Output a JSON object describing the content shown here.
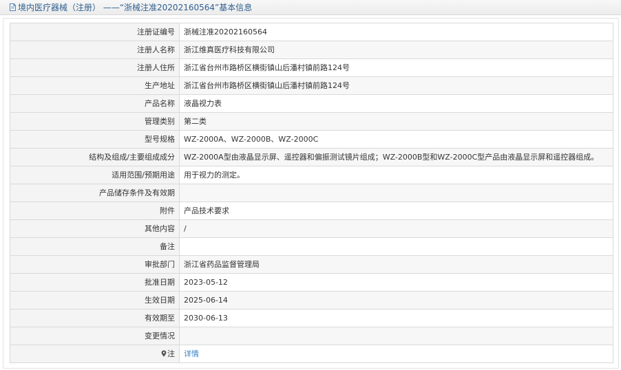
{
  "header": {
    "title": "境内医疗器械（注册） ——“浙械注准20202160564”基本信息",
    "icon": "document-icon"
  },
  "rows": [
    {
      "label": "注册证编号",
      "value": "浙械注准20202160564"
    },
    {
      "label": "注册人名称",
      "value": "浙江维真医疗科技有限公司"
    },
    {
      "label": "注册人住所",
      "value": "浙江省台州市路桥区横街镇山后潘村镇前路124号"
    },
    {
      "label": "生产地址",
      "value": "浙江省台州市路桥区横街镇山后潘村镇前路124号"
    },
    {
      "label": "产品名称",
      "value": "液晶视力表"
    },
    {
      "label": "管理类别",
      "value": "第二类"
    },
    {
      "label": "型号规格",
      "value": "WZ-2000A、WZ-2000B、WZ-2000C"
    },
    {
      "label": "结构及组成/主要组成成分",
      "value": "WZ-2000A型由液晶显示屏、遥控器和偏振测试镜片组成；WZ-2000B型和WZ-2000C型产品由液晶显示屏和遥控器组成。"
    },
    {
      "label": "适用范围/预期用途",
      "value": "用于视力的测定。"
    },
    {
      "label": "产品储存条件及有效期",
      "value": ""
    },
    {
      "label": "附件",
      "value": "产品技术要求"
    },
    {
      "label": "其他内容",
      "value": "/"
    },
    {
      "label": "备注",
      "value": ""
    },
    {
      "label": "审批部门",
      "value": "浙江省药品监督管理局"
    },
    {
      "label": "批准日期",
      "value": "2023-05-12"
    },
    {
      "label": "生效日期",
      "value": "2025-06-14"
    },
    {
      "label": "有效期至",
      "value": "2030-06-13"
    },
    {
      "label": "变更情况",
      "value": ""
    }
  ],
  "note_row": {
    "label": "注",
    "link": "详情",
    "icon": "pin-icon"
  },
  "colors": {
    "header_text": "#2f5f8f",
    "link": "#3a7fc4",
    "border": "#d9d9d9",
    "label_bg": "#f4f4f4"
  }
}
